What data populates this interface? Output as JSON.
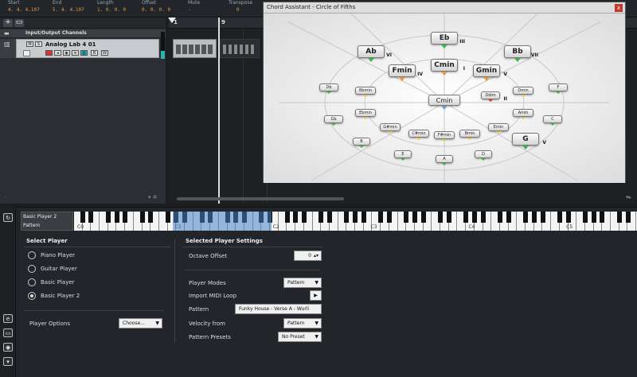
{
  "info_bar": [
    {
      "label": "Start",
      "value": "4. 4. 4.107"
    },
    {
      "label": "End",
      "value": "5. 4. 4.107"
    },
    {
      "label": "Length",
      "value": "1. 0. 0. 0"
    },
    {
      "label": "Offset",
      "value": "0. 0. 0. 0"
    },
    {
      "label": "Mute",
      "value": "-"
    },
    {
      "label": "Transpose",
      "value": "0"
    }
  ],
  "tracks": {
    "folder_name": "Input/Output Channels",
    "track_name": "Analog Lab 4 01",
    "btn_m": "M",
    "btn_s": "S",
    "btn_r": "R",
    "btn_w": "W"
  },
  "ruler": {
    "bar1": "1",
    "bar9": "9"
  },
  "chord_assistant": {
    "title": "Chord Assistant - Circle of Fifths",
    "close": "x",
    "chords": [
      {
        "name": "Eb",
        "deg": "III"
      },
      {
        "name": "Ab",
        "deg": "VI"
      },
      {
        "name": "Bb",
        "deg": "VII"
      },
      {
        "name": "Cmin",
        "deg": "I"
      },
      {
        "name": "Fmin",
        "deg": "IV"
      },
      {
        "name": "Gmin",
        "deg": "V"
      },
      {
        "name": "G",
        "deg": "V"
      },
      {
        "name": "Cmin"
      },
      {
        "name": "Db"
      },
      {
        "name": "Bbmin"
      },
      {
        "name": "Ddim",
        "deg": "II"
      },
      {
        "name": "Dmin"
      },
      {
        "name": "F"
      },
      {
        "name": "Ebmin"
      },
      {
        "name": "Amin"
      },
      {
        "name": "Gb"
      },
      {
        "name": "G#min"
      },
      {
        "name": "C"
      },
      {
        "name": "C#min"
      },
      {
        "name": "F#min"
      },
      {
        "name": "Bmin"
      },
      {
        "name": "Emin"
      },
      {
        "name": "B"
      },
      {
        "name": "E"
      },
      {
        "name": "D"
      },
      {
        "name": "A"
      }
    ]
  },
  "lower_zone": {
    "instrument": "Basic Player 2",
    "mode": "Pattern",
    "octaves": [
      "C0",
      "C1",
      "C2",
      "C3",
      "C4",
      "C5"
    ],
    "select_player_title": "Select Player",
    "players": [
      "Piano Player",
      "Guitar Player",
      "Basic Player",
      "Basic Player 2"
    ],
    "selected_player": "Basic Player 2",
    "player_options_label": "Player Options",
    "player_options_value": "Choose...",
    "settings_title": "Selected Player Settings",
    "octave_offset_label": "Octave Offset",
    "octave_offset_value": "0",
    "player_modes_label": "Player Modes",
    "player_modes_value": "Pattern",
    "import_midi_label": "Import MIDI Loop",
    "pattern_label": "Pattern",
    "pattern_value": "Funky House - Verse A - Wurli",
    "velocity_label": "Velocity from",
    "velocity_value": "Pattern",
    "presets_label": "Pattern Presets",
    "presets_value": "No Preset"
  }
}
